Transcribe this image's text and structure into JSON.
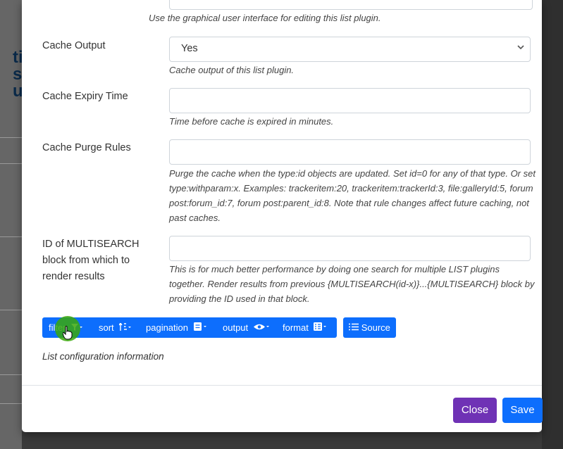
{
  "background": {
    "page_letters": "ti\ns\nu"
  },
  "fields": {
    "gui_help": "Use the graphical user interface for editing this list plugin.",
    "cache_output": {
      "label": "Cache Output",
      "value": "Yes",
      "help": "Cache output of this list plugin."
    },
    "cache_expiry": {
      "label": "Cache Expiry Time",
      "value": "",
      "help": "Time before cache is expired in minutes."
    },
    "cache_purge": {
      "label": "Cache Purge Rules",
      "value": "",
      "help": "Purge the cache when the type:id objects are updated. Set id=0 for any of that type. Or set type:withparam:x. Examples: trackeritem:20, trackeritem:trackerId:3, file:galleryId:5, forum post:forum_id:7, forum post:parent_id:8. Note that rule changes affect future caching, not past caches."
    },
    "multisearch": {
      "label": "ID of MULTISEARCH block from which to render results",
      "value": "",
      "help": "This is for much better performance by doing one search for multiple LIST plugins together. Render results from previous {MULTISEARCH(id-x)}...{MULTISEARCH} block by providing the ID used in that block."
    }
  },
  "toolbar": {
    "filter": "filter",
    "sort": "sort",
    "pagination": "pagination",
    "output": "output",
    "format": "format",
    "source": "Source"
  },
  "config_info": "List configuration information",
  "footer": {
    "close": "Close",
    "save": "Save"
  },
  "colors": {
    "primary": "#0d6efd",
    "close": "#6f32b5",
    "cursor_highlight": "#3aa80a"
  }
}
